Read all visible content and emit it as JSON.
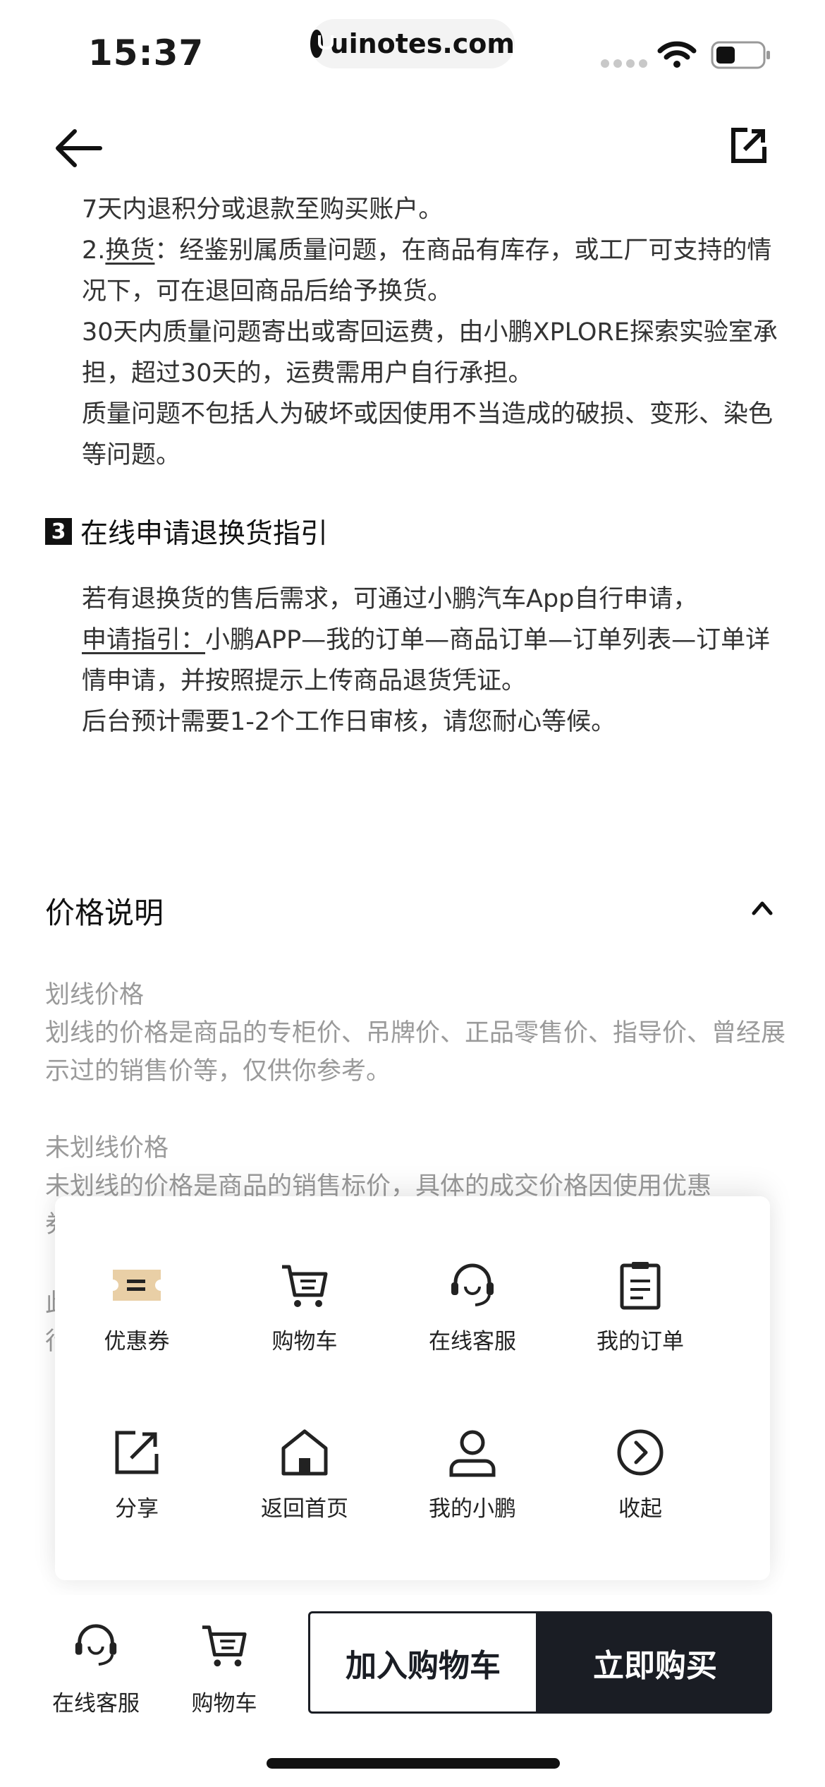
{
  "status_bar": {
    "time": "15:37",
    "url": "uinotes.com"
  },
  "return_policy": {
    "line_a": "7天内退积分或退款至购买账户。",
    "exchange_prefix": "2.",
    "exchange_word": "换货",
    "exchange_text": "：经鉴别属质量问题，在商品有库存，或工厂可支持的情况下，可在退回商品后给予换货。",
    "shipping_text": "30天内质量问题寄出或寄回运费，由小鹏XPLORE探索实验室承担，超过30天的，运费需用户自行承担。",
    "quality_text": "质量问题不包括人为破坏或因使用不当造成的破损、变形、染色等问题。"
  },
  "section3": {
    "number": "3",
    "title": "在线申请退换货指引",
    "p1": "若有退换货的售后需求，可通过小鹏汽车App自行申请，",
    "guide_label": "申请指引：",
    "guide_text": "小鹏APP—我的订单—商品订单—订单列表—订单详情申请，并按照提示上传商品退货凭证。",
    "p3": "后台预计需要1-2个工作日审核，请您耐心等候。"
  },
  "price_info": {
    "title": "价格说明",
    "strike_title": "划线价格",
    "strike_text": "划线的价格是商品的专柜价、吊牌价、正品零售价、指导价、曾经展示过的销售价等，仅供你参考。",
    "nostrike_title": "未划线价格",
    "nostrike_text": "未划线的价格是商品的销售标价，具体的成交价格因使用优惠"
  },
  "menu": {
    "items": [
      {
        "label": "优惠券",
        "icon": "coupon-icon"
      },
      {
        "label": "购物车",
        "icon": "cart-icon"
      },
      {
        "label": "在线客服",
        "icon": "headset-icon"
      },
      {
        "label": "我的订单",
        "icon": "order-clipboard-icon"
      },
      {
        "label": "分享",
        "icon": "share-icon"
      },
      {
        "label": "返回首页",
        "icon": "home-icon"
      },
      {
        "label": "我的小鹏",
        "icon": "user-icon"
      },
      {
        "label": "收起",
        "icon": "collapse-chevron-icon"
      }
    ]
  },
  "bottom_bar": {
    "service_label": "在线客服",
    "cart_label": "购物车",
    "add_to_cart": "加入购物车",
    "buy_now": "立即购买"
  },
  "colors": {
    "accent_dark": "#1a1d24",
    "coupon_gold": "#e9cfa6",
    "muted_text": "#9a9a9a"
  }
}
